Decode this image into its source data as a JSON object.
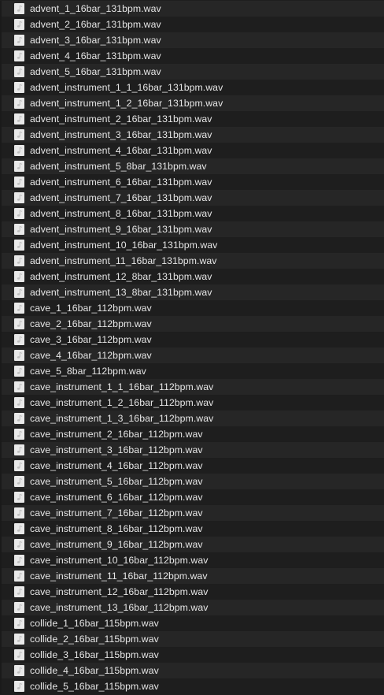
{
  "files": [
    {
      "name": "advent_1_16bar_131bpm.wav",
      "icon": "audio-file-icon"
    },
    {
      "name": "advent_2_16bar_131bpm.wav",
      "icon": "audio-file-icon"
    },
    {
      "name": "advent_3_16bar_131bpm.wav",
      "icon": "audio-file-icon"
    },
    {
      "name": "advent_4_16bar_131bpm.wav",
      "icon": "audio-file-icon"
    },
    {
      "name": "advent_5_16bar_131bpm.wav",
      "icon": "audio-file-icon"
    },
    {
      "name": "advent_instrument_1_1_16bar_131bpm.wav",
      "icon": "audio-file-icon"
    },
    {
      "name": "advent_instrument_1_2_16bar_131bpm.wav",
      "icon": "audio-file-icon"
    },
    {
      "name": "advent_instrument_2_16bar_131bpm.wav",
      "icon": "audio-file-icon"
    },
    {
      "name": "advent_instrument_3_16bar_131bpm.wav",
      "icon": "audio-file-icon"
    },
    {
      "name": "advent_instrument_4_16bar_131bpm.wav",
      "icon": "audio-file-icon"
    },
    {
      "name": "advent_instrument_5_8bar_131bpm.wav",
      "icon": "audio-file-icon"
    },
    {
      "name": "advent_instrument_6_16bar_131bpm.wav",
      "icon": "audio-file-icon"
    },
    {
      "name": "advent_instrument_7_16bar_131bpm.wav",
      "icon": "audio-file-icon"
    },
    {
      "name": "advent_instrument_8_16bar_131bpm.wav",
      "icon": "audio-file-icon"
    },
    {
      "name": "advent_instrument_9_16bar_131bpm.wav",
      "icon": "audio-file-icon"
    },
    {
      "name": "advent_instrument_10_16bar_131bpm.wav",
      "icon": "audio-file-icon"
    },
    {
      "name": "advent_instrument_11_16bar_131bpm.wav",
      "icon": "audio-file-icon"
    },
    {
      "name": "advent_instrument_12_8bar_131bpm.wav",
      "icon": "audio-file-icon"
    },
    {
      "name": "advent_instrument_13_8bar_131bpm.wav",
      "icon": "audio-file-icon"
    },
    {
      "name": "cave_1_16bar_112bpm.wav",
      "icon": "audio-file-icon"
    },
    {
      "name": "cave_2_16bar_112bpm.wav",
      "icon": "audio-file-icon"
    },
    {
      "name": "cave_3_16bar_112bpm.wav",
      "icon": "audio-file-icon"
    },
    {
      "name": "cave_4_16bar_112bpm.wav",
      "icon": "audio-file-icon"
    },
    {
      "name": "cave_5_8bar_112bpm.wav",
      "icon": "audio-file-icon"
    },
    {
      "name": "cave_instrument_1_1_16bar_112bpm.wav",
      "icon": "audio-file-icon"
    },
    {
      "name": "cave_instrument_1_2_16bar_112bpm.wav",
      "icon": "audio-file-icon"
    },
    {
      "name": "cave_instrument_1_3_16bar_112bpm.wav",
      "icon": "audio-file-icon"
    },
    {
      "name": "cave_instrument_2_16bar_112bpm.wav",
      "icon": "audio-file-icon"
    },
    {
      "name": "cave_instrument_3_16bar_112bpm.wav",
      "icon": "audio-file-icon"
    },
    {
      "name": "cave_instrument_4_16bar_112bpm.wav",
      "icon": "audio-file-icon"
    },
    {
      "name": "cave_instrument_5_16bar_112bpm.wav",
      "icon": "audio-file-icon"
    },
    {
      "name": "cave_instrument_6_16bar_112bpm.wav",
      "icon": "audio-file-icon"
    },
    {
      "name": "cave_instrument_7_16bar_112bpm.wav",
      "icon": "audio-file-icon"
    },
    {
      "name": "cave_instrument_8_16bar_112bpm.wav",
      "icon": "audio-file-icon"
    },
    {
      "name": "cave_instrument_9_16bar_112bpm.wav",
      "icon": "audio-file-icon"
    },
    {
      "name": "cave_instrument_10_16bar_112bpm.wav",
      "icon": "audio-file-icon"
    },
    {
      "name": "cave_instrument_11_16bar_112bpm.wav",
      "icon": "audio-file-icon"
    },
    {
      "name": "cave_instrument_12_16bar_112bpm.wav",
      "icon": "audio-file-icon"
    },
    {
      "name": "cave_instrument_13_16bar_112bpm.wav",
      "icon": "audio-file-icon"
    },
    {
      "name": "collide_1_16bar_115bpm.wav",
      "icon": "audio-file-icon"
    },
    {
      "name": "collide_2_16bar_115bpm.wav",
      "icon": "audio-file-icon"
    },
    {
      "name": "collide_3_16bar_115bpm.wav",
      "icon": "audio-file-icon"
    },
    {
      "name": "collide_4_16bar_115bpm.wav",
      "icon": "audio-file-icon"
    },
    {
      "name": "collide_5_16bar_115bpm.wav",
      "icon": "audio-file-icon"
    }
  ],
  "colors": {
    "background": "#1e1e1e",
    "row_alt": "#262626",
    "text": "#e6e6e6",
    "icon": "#e9e9e9"
  }
}
